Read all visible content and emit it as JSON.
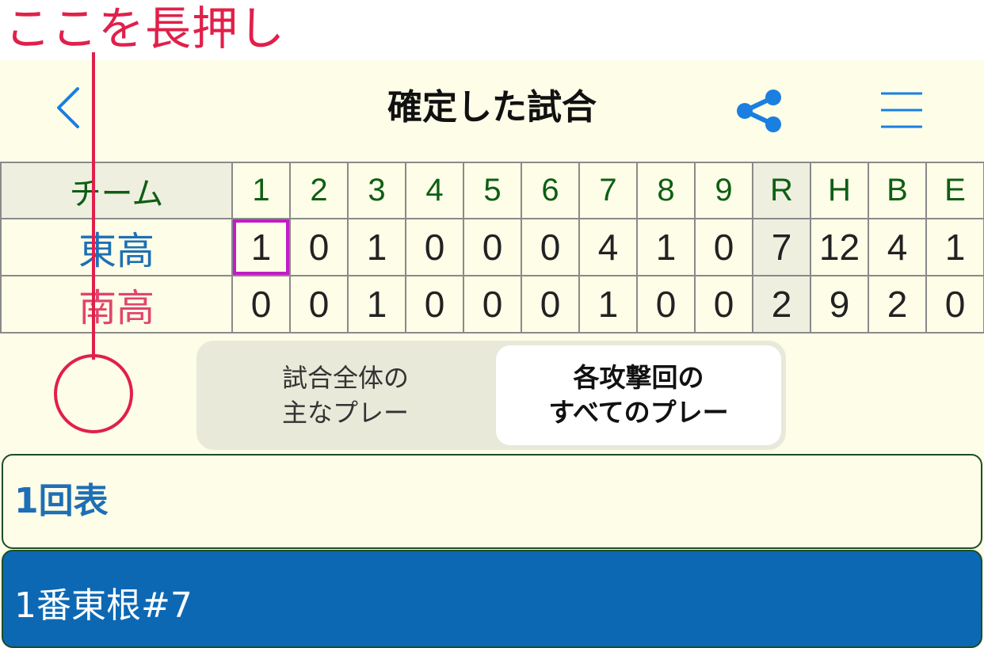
{
  "annotation": {
    "label": "ここを長押し",
    "color": "#e0204a"
  },
  "nav": {
    "title": "確定した試合",
    "back_icon": "chevron-left-icon",
    "share_icon": "share-icon",
    "menu_icon": "hamburger-menu-icon",
    "accent": "#1a7fe0"
  },
  "scoreboard": {
    "team_header": "チーム",
    "columns": [
      "1",
      "2",
      "3",
      "4",
      "5",
      "6",
      "7",
      "8",
      "9",
      "R",
      "H",
      "B",
      "E"
    ],
    "teams": [
      {
        "name": "東高",
        "color": "#1e6fb5",
        "values": [
          "1",
          "0",
          "1",
          "0",
          "0",
          "0",
          "4",
          "1",
          "0",
          "7",
          "12",
          "4",
          "1"
        ]
      },
      {
        "name": "南高",
        "color": "#e0456d",
        "values": [
          "0",
          "0",
          "1",
          "0",
          "0",
          "0",
          "1",
          "0",
          "0",
          "2",
          "9",
          "2",
          "0"
        ]
      }
    ],
    "selected_cell": {
      "team": "東高",
      "inning": "1"
    }
  },
  "segment": {
    "left_line1": "試合全体の",
    "left_line2": "主なプレー",
    "right_line1": "各攻撃回の",
    "right_line2": "すべてのプレー",
    "selected": "right"
  },
  "list": {
    "inning_header": "1回表",
    "batter": "1番東根#7"
  }
}
